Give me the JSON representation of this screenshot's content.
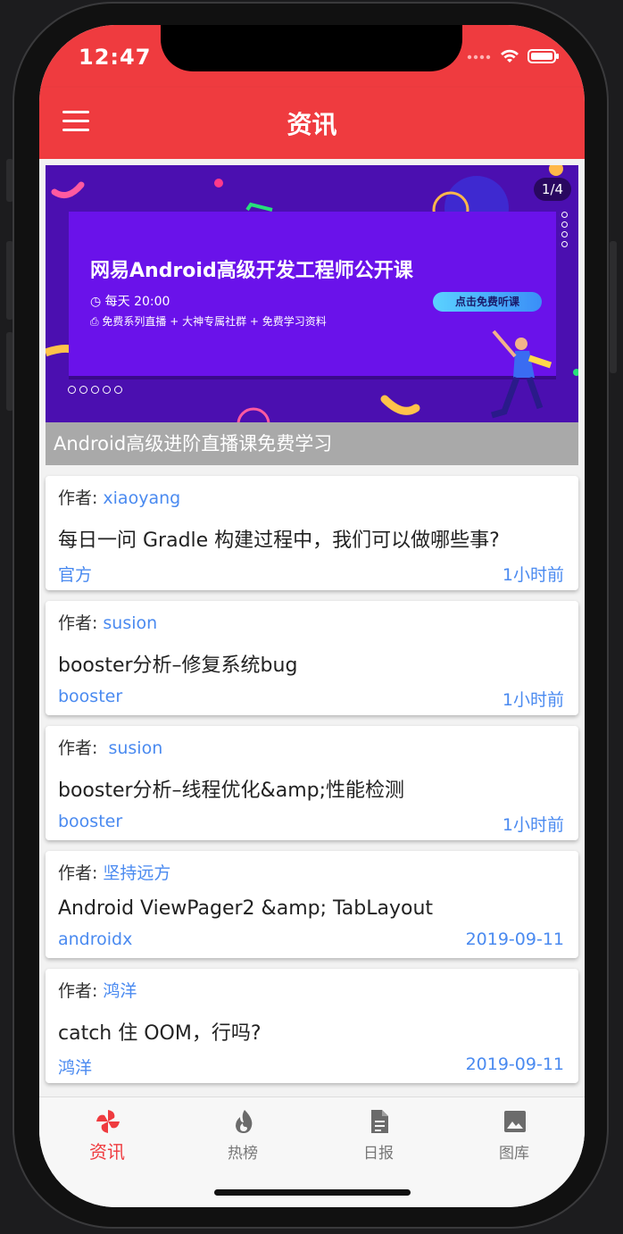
{
  "status": {
    "time": "12:47"
  },
  "appbar": {
    "title": "资讯"
  },
  "banner": {
    "page_indicator": "1/4",
    "headline": "网易Android高级开发工程师公开课",
    "schedule": "每天 20:00",
    "perks": "免费系列直播 + 大神专属社群 + 免费学习资料",
    "cta": "点击免费听课",
    "caption": "Android高级进阶直播课免费学习"
  },
  "articles": [
    {
      "author_label": "作者:",
      "author": "xiaoyang",
      "title": "每日一问 Gradle 构建过程中，我们可以做哪些事?",
      "tag": "官方",
      "time": "1小时前"
    },
    {
      "author_label": "作者:",
      "author": "susion",
      "title": "booster分析–修复系统bug",
      "tag": "booster",
      "time": "1小时前"
    },
    {
      "author_label": "作者:",
      "author": " susion",
      "title": "booster分析–线程优化&amp;性能检测",
      "tag": "booster",
      "time": "1小时前"
    },
    {
      "author_label": "作者:",
      "author": "坚持远方",
      "title": "Android ViewPager2 &amp; TabLayout",
      "tag": "androidx",
      "time": "2019-09-11"
    },
    {
      "author_label": "作者:",
      "author": "鸿洋",
      "title": "catch 住 OOM，行吗?",
      "tag": "鸿洋",
      "time": "2019-09-11"
    }
  ],
  "tabs": [
    {
      "label": "资讯",
      "icon": "pinwheel-icon",
      "active": true
    },
    {
      "label": "热榜",
      "icon": "fire-icon",
      "active": false
    },
    {
      "label": "日报",
      "icon": "document-icon",
      "active": false
    },
    {
      "label": "图库",
      "icon": "image-icon",
      "active": false
    }
  ],
  "colors": {
    "primary": "#ef3b3f",
    "link": "#4a8af0",
    "banner_bg": "#4b0fb0"
  }
}
